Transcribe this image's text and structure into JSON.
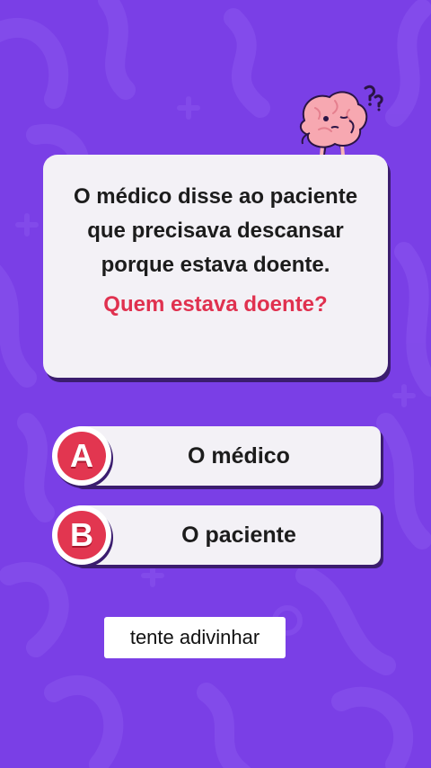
{
  "question": {
    "text": "O médico disse ao paciente que precisava descansar porque estava doente.",
    "prompt": "Quem estava doente?"
  },
  "answers": [
    {
      "letter": "A",
      "label": "O médico"
    },
    {
      "letter": "B",
      "label": "O paciente"
    }
  ],
  "hint_button": {
    "label": "tente adivinhar"
  },
  "mascot": {
    "icon": "brain-mascot-icon",
    "symbol": "?"
  },
  "colors": {
    "background": "#7a3fe6",
    "card": "#f3f1f6",
    "accent_red": "#e0314f",
    "shadow": "#3b1d6e"
  }
}
